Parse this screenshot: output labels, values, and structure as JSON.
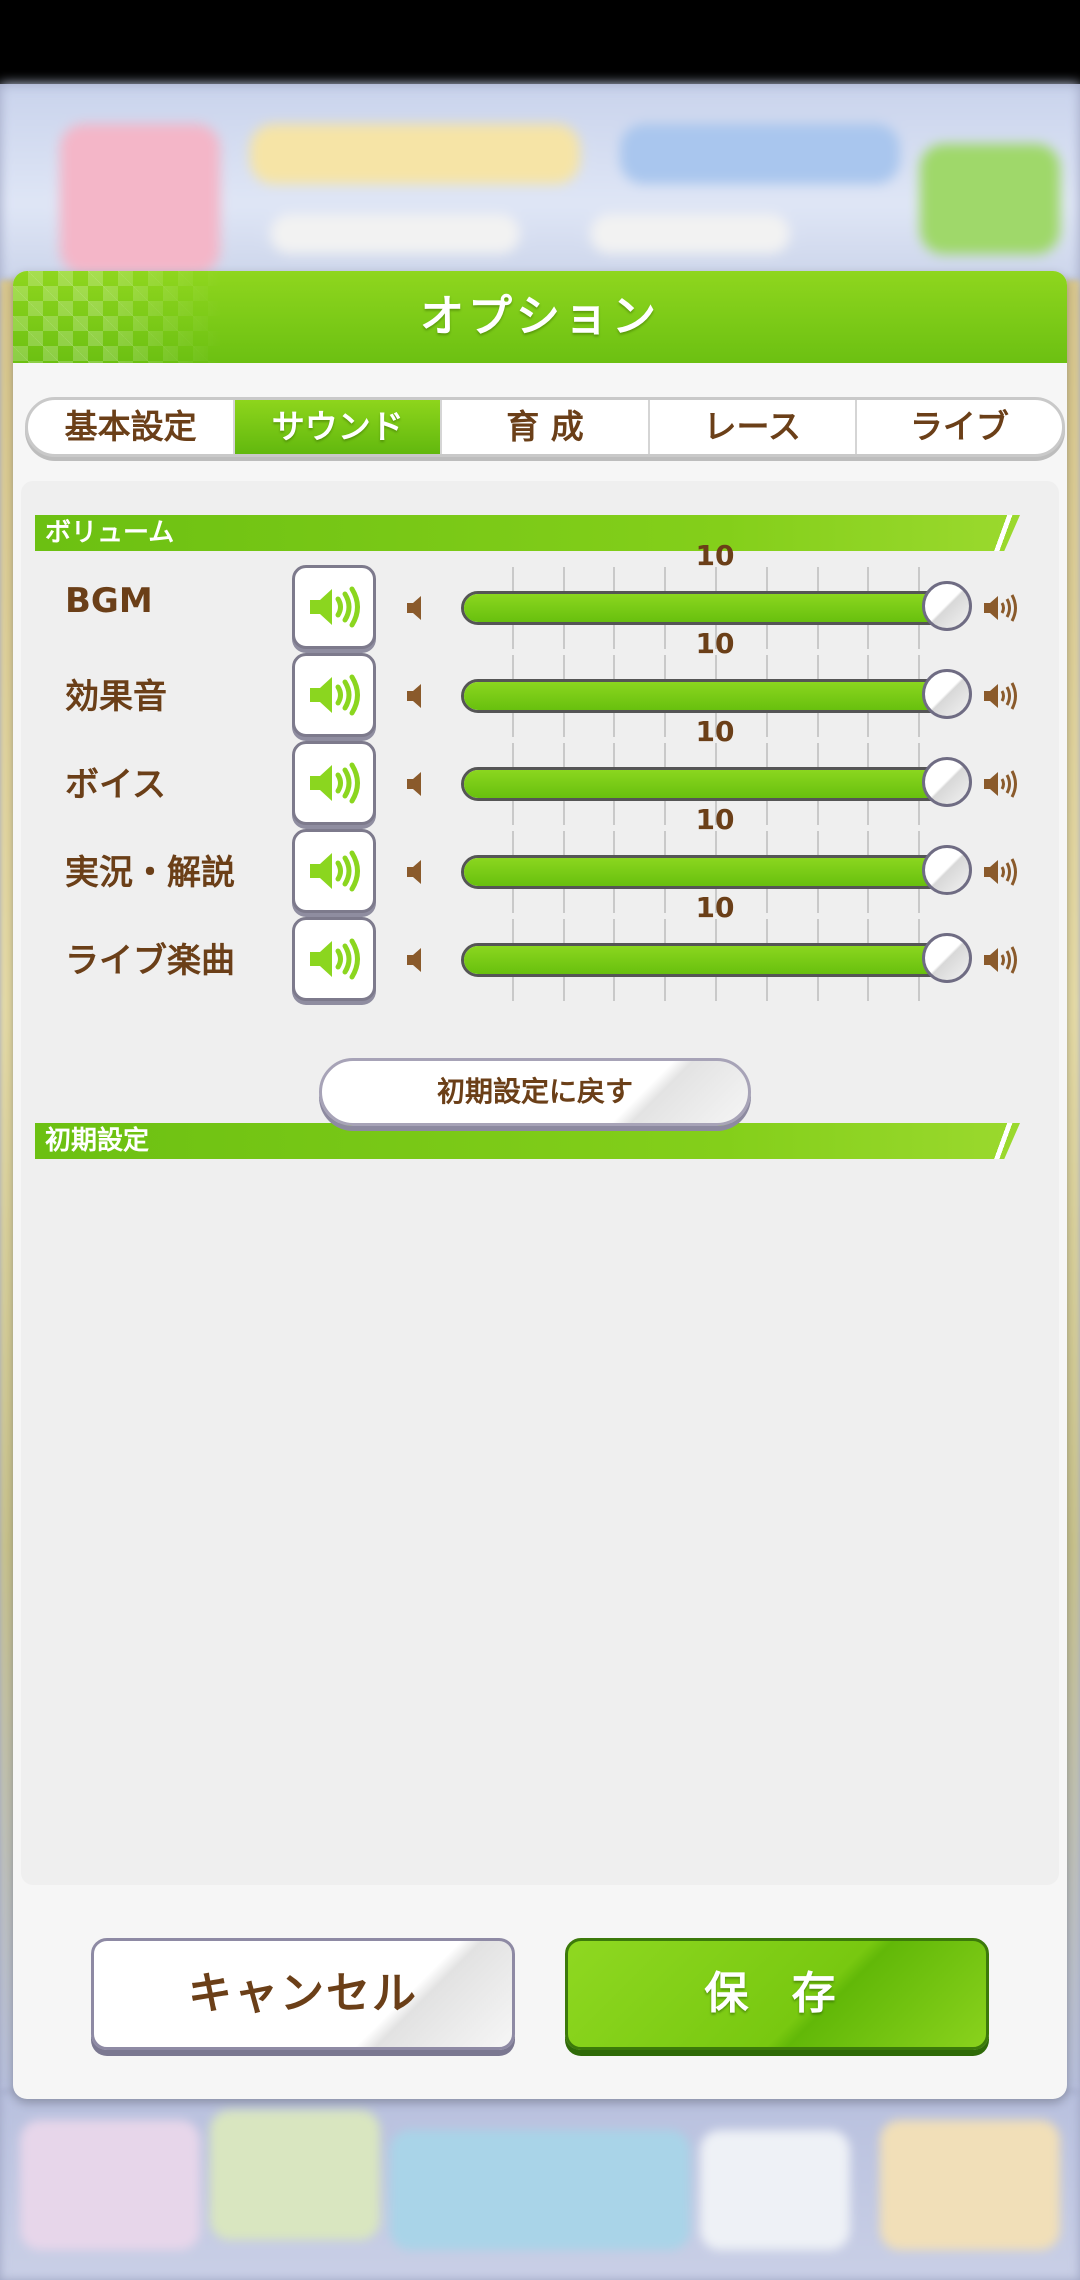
{
  "dialog": {
    "title": "オプション",
    "tabs": [
      {
        "label": "基本設定",
        "active": false
      },
      {
        "label": "サウンド",
        "active": true
      },
      {
        "label": "育 成",
        "active": false
      },
      {
        "label": "レース",
        "active": false
      },
      {
        "label": "ライブ",
        "active": false
      }
    ]
  },
  "volume_section": {
    "title": "ボリューム",
    "rows": [
      {
        "label": "BGM",
        "value": "10",
        "level": 1.0,
        "muted": false
      },
      {
        "label": "効果音",
        "value": "10",
        "level": 1.0,
        "muted": false
      },
      {
        "label": "ボイス",
        "value": "10",
        "level": 1.0,
        "muted": false
      },
      {
        "label": "実況・解説",
        "value": "10",
        "level": 1.0,
        "muted": false
      },
      {
        "label": "ライブ楽曲",
        "value": "10",
        "level": 1.0,
        "muted": false
      }
    ],
    "icons": {
      "mute_toggle": "speaker-on-icon",
      "min": "volume-low-icon",
      "max": "volume-high-icon"
    }
  },
  "reset_section": {
    "title": "初期設定",
    "reset_button": "初期設定に戻す"
  },
  "footer": {
    "cancel_button": "キャンセル",
    "save_button": "保 存"
  },
  "colors": {
    "accent_green": "#76c814",
    "text_brown": "#6b3f18"
  }
}
